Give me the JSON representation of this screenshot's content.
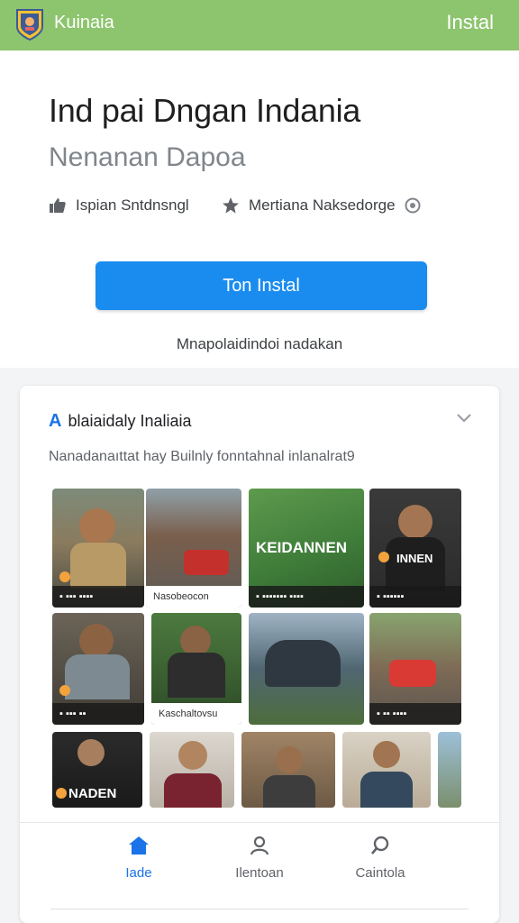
{
  "header": {
    "brand": "Kuinaia",
    "install_label": "Instal"
  },
  "app": {
    "title": "Ind pai Dngan Indania",
    "subtitle": "Nenanan Dapoa",
    "meta1": "Ispian Sntdnsngl",
    "meta2": "Mertiana Naksedorge",
    "cta_label": "Ton Instal",
    "note": "Mnapolaidindoi nadakan"
  },
  "card": {
    "title_prefix": "A",
    "title": "blaiaidaly Inaliaia",
    "description": "Nanadanaıttat hay Builnly fonntahnal inlanalrat9"
  },
  "gallery": {
    "t1_caption": "",
    "t2_caption": "Nasobeocon",
    "t3_overlay": "KEIDANNEN",
    "t4_overlay": "INNEN",
    "t6_caption": "Kaschaltovsu",
    "t9_overlay": "NADEN"
  },
  "nav": {
    "items": [
      {
        "label": "Iade"
      },
      {
        "label": "Ilentoan"
      },
      {
        "label": "Caintola"
      }
    ]
  },
  "colors": {
    "topbar": "#8dc46e",
    "accent": "#1a8cf0",
    "nav_active": "#1a73e8"
  }
}
